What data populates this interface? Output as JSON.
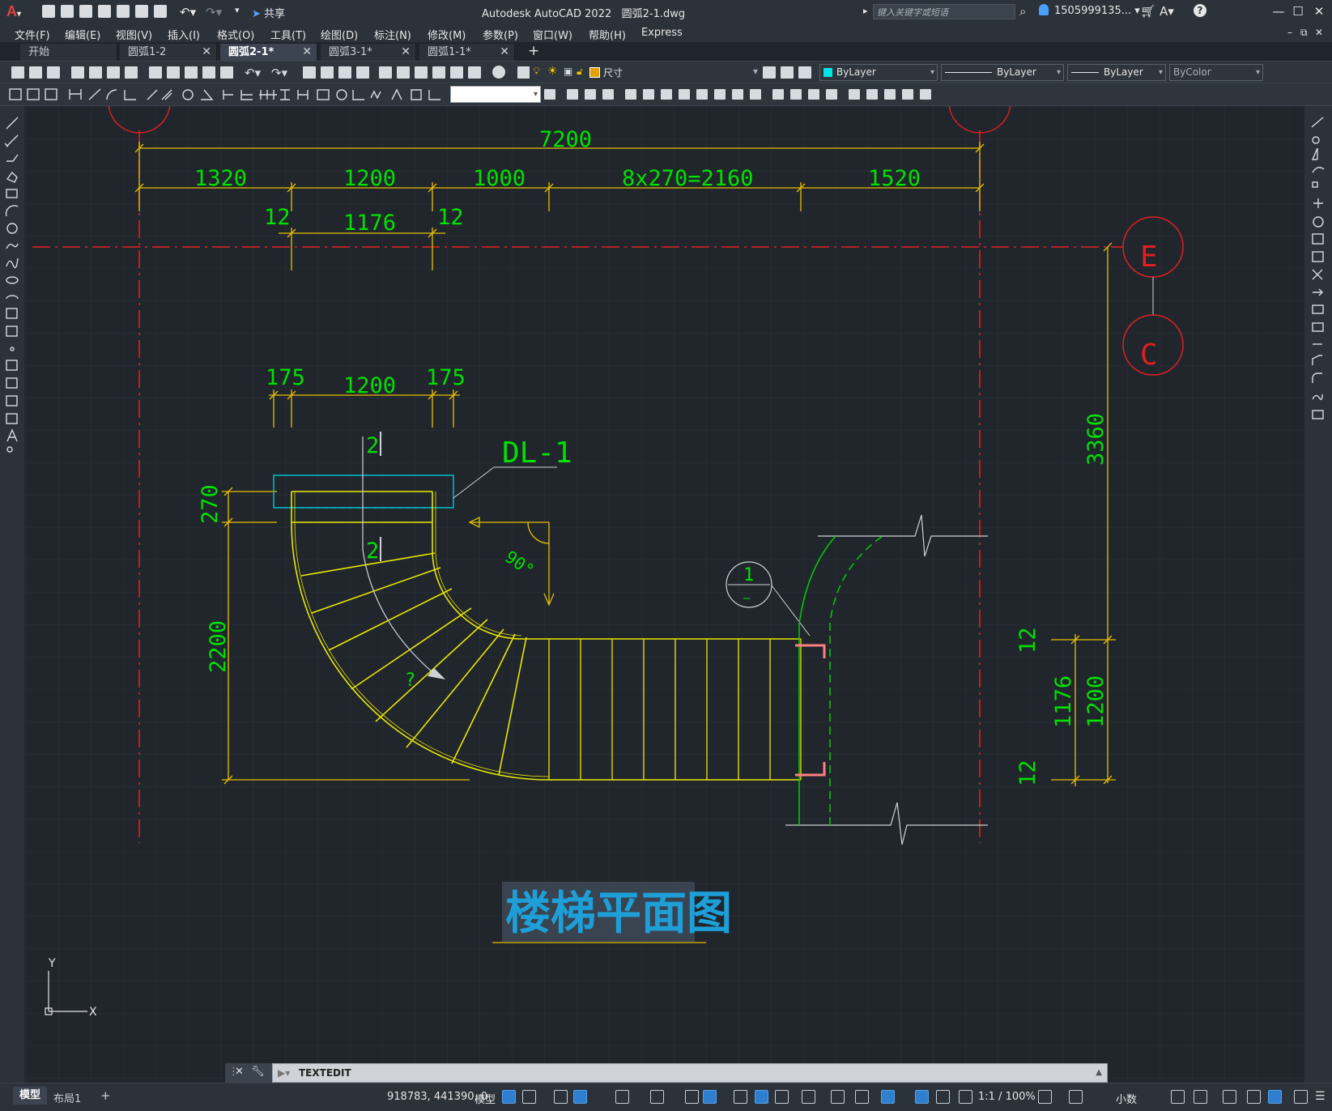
{
  "app": {
    "title": "Autodesk AutoCAD 2022",
    "file": "圆弧2-1.dwg",
    "icon_letter": "A",
    "share_label": "共享",
    "search_placeholder": "键入关键字或短语",
    "user": "1505999135... ▾"
  },
  "menu": [
    "文件(F)",
    "编辑(E)",
    "视图(V)",
    "插入(I)",
    "格式(O)",
    "工具(T)",
    "绘图(D)",
    "标注(N)",
    "修改(M)",
    "参数(P)",
    "窗口(W)",
    "帮助(H)",
    "Express"
  ],
  "tabs": [
    {
      "label": "开始",
      "close": ""
    },
    {
      "label": "圆弧1-2",
      "close": "✕"
    },
    {
      "label": "圆弧2-1*",
      "close": "✕"
    },
    {
      "label": "圆弧3-1*",
      "close": "✕"
    },
    {
      "label": "圆弧1-1*",
      "close": "✕"
    }
  ],
  "tab_add": "+",
  "props": {
    "layer": "尺寸",
    "color": "ByLayer",
    "linetype": "ByLayer",
    "lineweight": "ByLayer",
    "plotstyle": "ByColor",
    "colors": {
      "accent": "#00e5e5",
      "layer_swatch": "#e0a000"
    }
  },
  "drawing": {
    "dim_total": "7200",
    "dim_1320": "1320",
    "dim_1200": "1200",
    "dim_1000": "1000",
    "dim_steps": "8x270=2160",
    "dim_1520": "1520",
    "dim_12a": "12",
    "dim_1176": "1176",
    "dim_12b": "12",
    "dim_175a": "175",
    "dim_1200b": "1200",
    "dim_175b": "175",
    "sec_label_top": "2",
    "sec_label_mid": "2",
    "beam_label": "DL-1",
    "dim_270": "270",
    "dim_2200": "2200",
    "angle": "90°",
    "unknown": "?",
    "detail_num": "1",
    "detail_sub": "—",
    "dim_3360": "3360",
    "dim_12c": "12",
    "dim_1176b": "1176",
    "dim_1200c": "1200",
    "dim_12d": "12",
    "axis_e": "E",
    "axis_c": "C",
    "plan_title": "楼梯平面图",
    "ucs_y": "Y",
    "ucs_x": "X",
    "colors": {
      "dim": "#e6c000",
      "text": "#00e000",
      "axis": "#e02020",
      "stair": "#e8e800",
      "beam": "#00c8d8",
      "wall": "#00d000"
    }
  },
  "command": {
    "text": "TEXTEDIT"
  },
  "layout_tabs": [
    "模型",
    "布局1",
    "+"
  ],
  "status": {
    "coords": "918783, 441390, 0",
    "mode": "模型",
    "scale": "1:1 / 100%",
    "units": "小数"
  }
}
